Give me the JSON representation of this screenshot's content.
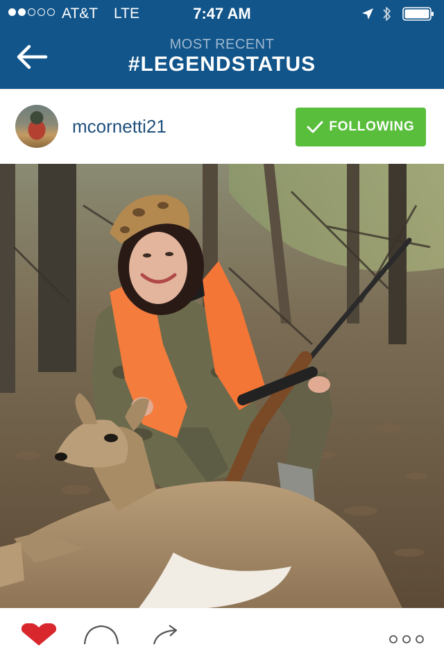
{
  "status_bar": {
    "signal_dots_filled": 2,
    "signal_dots_total": 5,
    "carrier": "AT&T",
    "network": "LTE",
    "time": "7:47 AM"
  },
  "nav": {
    "subtitle": "MOST RECENT",
    "title": "#LEGENDSTATUS"
  },
  "post": {
    "username": "mcornetti21",
    "follow_label": "FOLLOWING"
  },
  "icons": {
    "back": "back-arrow-icon",
    "location": "location-arrow-icon",
    "bluetooth": "bluetooth-icon",
    "battery": "battery-icon",
    "check": "checkmark-icon",
    "like": "heart-icon",
    "comment": "comment-bubble-icon",
    "share": "share-arrow-icon",
    "more": "more-dots-icon"
  },
  "colors": {
    "nav_bar": "#12558a",
    "follow_button": "#58be3b",
    "username": "#1f4f7b",
    "like_active": "#d8272d"
  }
}
